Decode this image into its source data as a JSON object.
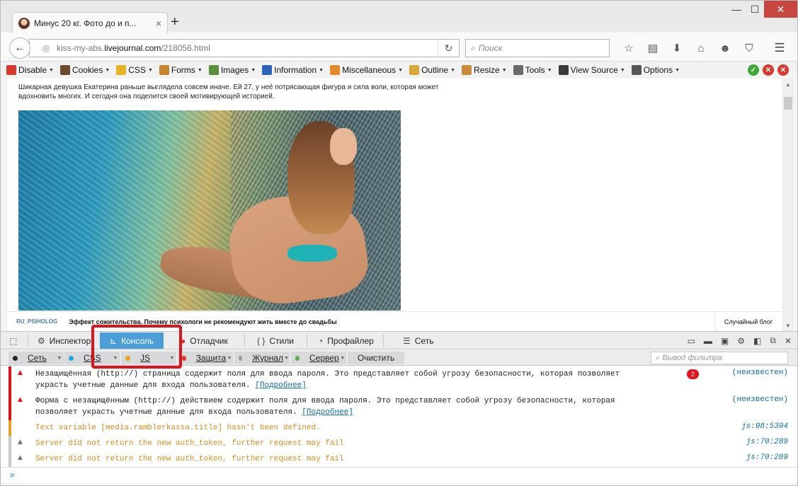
{
  "browser": {
    "tab_title": "Минус 20 кг. Фото до и п...",
    "tab_close": "×",
    "new_tab": "+",
    "win_min": "—",
    "win_max": "☐",
    "win_close": "✕",
    "url_prefix": "kiss-my-abs.",
    "url_domain": "livejournal.com",
    "url_path": "/218056.html",
    "search_placeholder": "Поиск"
  },
  "webdev_toolbar": [
    {
      "label": "Disable",
      "icon": "disable-icon",
      "color": "#d9382e"
    },
    {
      "label": "Cookies",
      "icon": "cookies-icon",
      "color": "#6b4b2a"
    },
    {
      "label": "CSS",
      "icon": "css-icon",
      "color": "#e6b422"
    },
    {
      "label": "Forms",
      "icon": "forms-icon",
      "color": "#c7862d"
    },
    {
      "label": "Images",
      "icon": "images-icon",
      "color": "#5a8f3d"
    },
    {
      "label": "Information",
      "icon": "information-icon",
      "color": "#2a63b8"
    },
    {
      "label": "Miscellaneous",
      "icon": "miscellaneous-icon",
      "color": "#e08a2a"
    },
    {
      "label": "Outline",
      "icon": "outline-icon",
      "color": "#d9a63a"
    },
    {
      "label": "Resize",
      "icon": "resize-icon",
      "color": "#c98b3a"
    },
    {
      "label": "Tools",
      "icon": "tools-icon",
      "color": "#6a6a6a"
    },
    {
      "label": "View Source",
      "icon": "view-source-icon",
      "color": "#3a3a3a"
    },
    {
      "label": "Options",
      "icon": "options-icon",
      "color": "#555555"
    }
  ],
  "page": {
    "intro": "Шикарная девушка Екатерина раньше выглядела совсем иначе. Ей 27, у неё потрясающая фигура и сила воли, которая может вдохновить многих. И сегодня она поделится своей мотивирующей историей.",
    "lj_user": "RU_PSIHOLOG",
    "lj_title": "Эффект сожительства. Почему психологи не рекомендуют жить вместе до свадьбы",
    "random_blog": "Случайный блог"
  },
  "devtools": {
    "tabs": [
      {
        "label": "Инспектор",
        "icon": "inspector-icon"
      },
      {
        "label": "Консоль",
        "icon": "console-icon"
      },
      {
        "label": "Отладчик",
        "icon": "debugger-icon"
      },
      {
        "label": "Стили",
        "icon": "styles-icon"
      },
      {
        "label": "Профайлер",
        "icon": "profiler-icon"
      },
      {
        "label": "Сеть",
        "icon": "network-icon"
      }
    ],
    "active_tab": "Консоль",
    "filters": [
      {
        "label": "Сеть",
        "color": "#222222"
      },
      {
        "label": "CSS",
        "color": "#2aa4e0"
      },
      {
        "label": "JS",
        "color": "#e8a125"
      },
      {
        "label": "Защита",
        "color": "#d9382e"
      },
      {
        "label": "Журнал",
        "color": "#999999"
      },
      {
        "label": "Сервер",
        "color": "#5aab4a"
      }
    ],
    "clear_label": "Очистить",
    "filter_placeholder": "Вывод фильтра",
    "messages": [
      {
        "text": "Незащищённая (http://) страница содержит поля для ввода пароля. Это представляет собой угрозу безопасности, которая позволяет\nукрасть учетные данные для входа пользователя. ",
        "link": "[Подробнее]",
        "badge": "2",
        "source": "(неизвестен)",
        "level": "security"
      },
      {
        "text": "Форма с незащищённым (http://) действием содержит поля для ввода пароля. Это представляет собой угрозу безопасности, которая\nпозволяет украсть учетные данные для входа пользователя. ",
        "link": "[Подробнее]",
        "source": "(неизвестен)",
        "level": "security"
      },
      {
        "text": "Text variable [media.ramblerkassa.title] hasn't been defined.",
        "source": "js:98:5394",
        "level": "js"
      },
      {
        "text": "Server did not return the new auth_token, further request may fail",
        "source": "js:70:289",
        "level": "js-warning"
      },
      {
        "text": "Server did not return the new auth_token, further request may fail",
        "source": "js:70:289",
        "level": "js-warning"
      }
    ],
    "prompt": "»"
  },
  "colors": {
    "accent": "#4c9ed9",
    "error": "#e0121b",
    "js_text": "#d98a1a",
    "link": "#0b6aa6"
  }
}
